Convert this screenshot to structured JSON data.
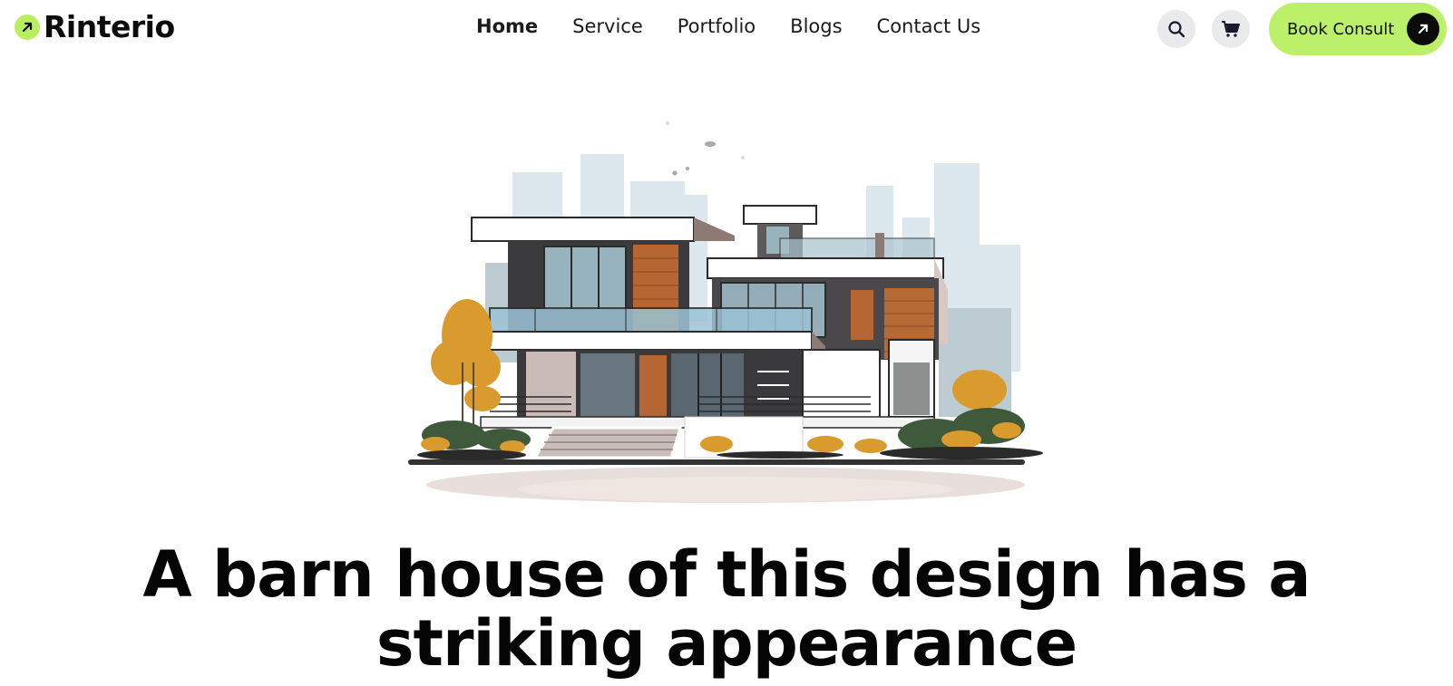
{
  "brand": {
    "name": "Rinterio",
    "accent": "#b9ee5e"
  },
  "nav": {
    "items": [
      {
        "label": "Home",
        "active": true
      },
      {
        "label": "Service",
        "active": false
      },
      {
        "label": "Portfolio",
        "active": false
      },
      {
        "label": "Blogs",
        "active": false
      },
      {
        "label": "Contact Us",
        "active": false
      }
    ]
  },
  "header_actions": {
    "search_icon": "search-icon",
    "cart_icon": "cart-icon",
    "cta_label": "Book Consult",
    "cta_icon": "arrow-up-right-icon",
    "cta_color": "#bdf06a"
  },
  "hero": {
    "illustration": "modern-house-illustration",
    "title": "A barn house of this design has a striking appearance"
  }
}
